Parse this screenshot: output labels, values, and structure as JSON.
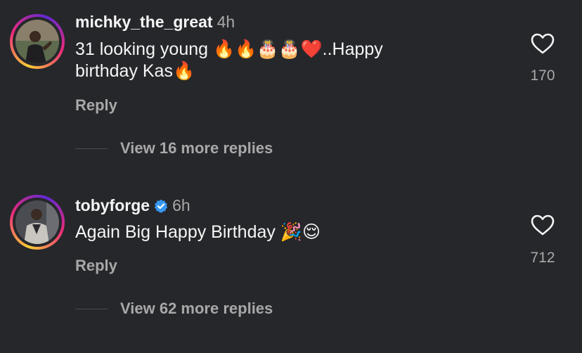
{
  "comments": [
    {
      "username": "michky_the_great",
      "time": "4h",
      "text_line1": "31 looking young 🔥🔥🎂🎂❤️..Happy",
      "text_line2": "birthday Kas🔥",
      "reply_label": "Reply",
      "view_replies": "View 16 more replies",
      "likes": "170",
      "verified": false
    },
    {
      "username": "tobyforge",
      "time": "6h",
      "text_line1": "Again Big Happy Birthday 🎉😌",
      "reply_label": "Reply",
      "view_replies": "View 62 more replies",
      "likes": "712",
      "verified": true
    }
  ],
  "colors": {
    "background": "#26272b",
    "text": "#f5f5f5",
    "secondary": "#a8a8a8",
    "verified": "#3797f0"
  },
  "icons": [
    "heart-icon",
    "verified-badge-icon"
  ]
}
